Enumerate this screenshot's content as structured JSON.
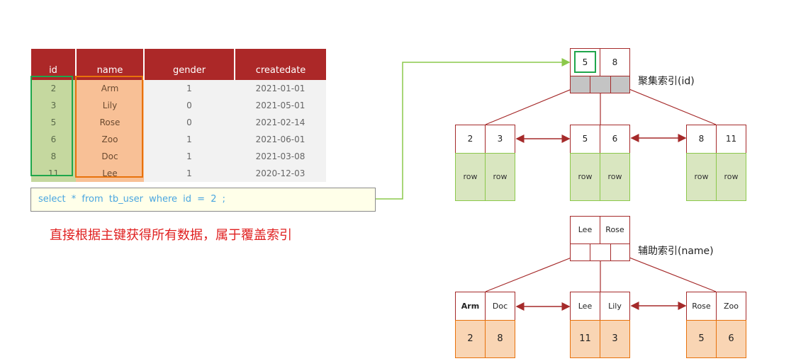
{
  "table": {
    "headers": [
      "id",
      "name",
      "gender",
      "createdate"
    ],
    "rows": [
      [
        "2",
        "Arm",
        "1",
        "2021-01-01"
      ],
      [
        "3",
        "Lily",
        "0",
        "2021-05-01"
      ],
      [
        "5",
        "Rose",
        "0",
        "2021-02-14"
      ],
      [
        "6",
        "Zoo",
        "1",
        "2021-06-01"
      ],
      [
        "8",
        "Doc",
        "1",
        "2021-03-08"
      ],
      [
        "11",
        "Lee",
        "1",
        "2020-12-03"
      ]
    ]
  },
  "sql": "select * from tb_user where id = 2 ;",
  "note": "直接根据主键获得所有数据，属于覆盖索引",
  "clustered_index": {
    "label": "聚集索引(id)",
    "root_keys": [
      "5",
      "8"
    ],
    "highlighted_key": "5",
    "leaves": [
      {
        "keys": [
          "2",
          "3"
        ],
        "values": [
          "row",
          "row"
        ]
      },
      {
        "keys": [
          "5",
          "6"
        ],
        "values": [
          "row",
          "row"
        ]
      },
      {
        "keys": [
          "8",
          "11"
        ],
        "values": [
          "row",
          "row"
        ]
      }
    ]
  },
  "secondary_index": {
    "label": "辅助索引(name)",
    "root_keys": [
      "Lee",
      "Rose"
    ],
    "leaves": [
      {
        "keys": [
          "Arm",
          "Doc"
        ],
        "values": [
          "2",
          "8"
        ]
      },
      {
        "keys": [
          "Lee",
          "Lily"
        ],
        "values": [
          "11",
          "3"
        ]
      },
      {
        "keys": [
          "Rose",
          "Zoo"
        ],
        "values": [
          "5",
          "6"
        ]
      }
    ]
  },
  "colors": {
    "header_red": "#ac2828",
    "tree_line": "#a52a2a",
    "sql_link": "#8cc84b",
    "highlight_green": "#1fa64b",
    "highlight_orange": "#e8720c"
  }
}
